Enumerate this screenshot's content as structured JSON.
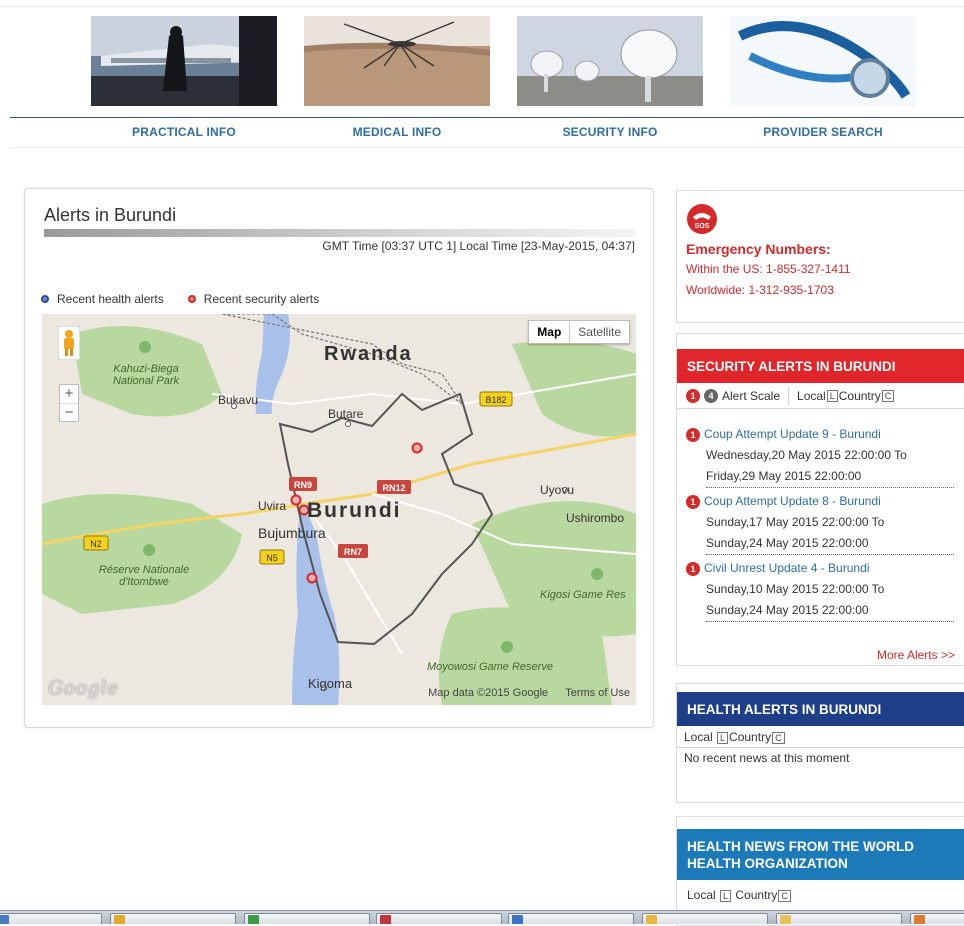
{
  "nav": {
    "items": [
      {
        "label": "PRACTICAL INFO"
      },
      {
        "label": "MEDICAL INFO"
      },
      {
        "label": "SECURITY INFO"
      },
      {
        "label": "PROVIDER SEARCH"
      }
    ]
  },
  "alerts_panel": {
    "title": "Alerts in Burundi",
    "time": "GMT Time [03:37 UTC 1] Local Time [23-May-2015, 04:37]",
    "legend": {
      "health": "Recent health alerts",
      "security": "Recent security alerts"
    },
    "map": {
      "type_buttons": {
        "map": "Map",
        "satellite": "Satellite"
      },
      "zoom": {
        "in": "+",
        "out": "−"
      },
      "labels": {
        "country_rwanda": "Rwanda",
        "country_burundi": "Burundi",
        "kahuzi": "Kahuzi-Biega",
        "kahuzi2": "National Park",
        "bukavu": "Bukavu",
        "butare": "Butare",
        "uvira": "Uvira",
        "bujumbura": "Bujumbura",
        "uyovu": "Uyovu",
        "ushirombo": "Ushirombo",
        "reserve1": "Réserve Nationale",
        "reserve2": "d'Itombwe",
        "kigosi": "Kigosi Game Res",
        "moyowosi": "Moyowosi Game Reserve",
        "kigoma": "Kigoma",
        "shield_b182": "B182",
        "shield_rn9": "RN9",
        "shield_rn12": "RN12",
        "shield_rn7": "RN7",
        "shield_n2": "N2",
        "shield_n5": "N5"
      },
      "google": "Google",
      "attribution": "Map data ©2015 Google",
      "terms": "Terms of Use"
    }
  },
  "emergency": {
    "sos_label": "SOS",
    "title": "Emergency Numbers:",
    "us": "Within the US: 1-855-327-1411",
    "world": "Worldwide: 1-312-935-1703"
  },
  "security_alerts": {
    "header": "SECURITY ALERTS IN BURUNDI",
    "scale": {
      "badge1": "1",
      "badge2": "4",
      "label": "Alert Scale",
      "local": "Local",
      "local_mark": "L",
      "country": "Country",
      "country_mark": "C"
    },
    "items": [
      {
        "badge": "1",
        "title": "Coup Attempt Update 9 - Burundi",
        "line1": "Wednesday,20 May 2015 22:00:00 To",
        "line2": "Friday,29 May 2015 22:00:00"
      },
      {
        "badge": "1",
        "title": "Coup Attempt Update 8 - Burundi",
        "line1": "Sunday,17 May 2015 22:00:00 To",
        "line2": "Sunday,24 May 2015 22:00:00"
      },
      {
        "badge": "1",
        "title": "Civil Unrest Update 4 - Burundi",
        "line1": "Sunday,10 May 2015 22:00:00 To",
        "line2": "Sunday,24 May 2015 22:00:00"
      }
    ],
    "more": "More Alerts >>"
  },
  "health_alerts": {
    "header": "HEALTH ALERTS IN BURUNDI",
    "local": "Local",
    "local_mark": "L",
    "country": "Country",
    "country_mark": "C",
    "empty": "No recent news at this moment"
  },
  "who_news": {
    "header1": "HEALTH NEWS FROM THE WORLD",
    "header2": "HEALTH ORGANIZATION",
    "local": "Local",
    "local_mark": "L",
    "country": "Country",
    "country_mark": "C"
  },
  "colors": {
    "security_red": "#e0262b",
    "health_navy": "#1e3f87",
    "who_blue": "#1c7ab9",
    "link_blue": "#2d6ea3"
  }
}
